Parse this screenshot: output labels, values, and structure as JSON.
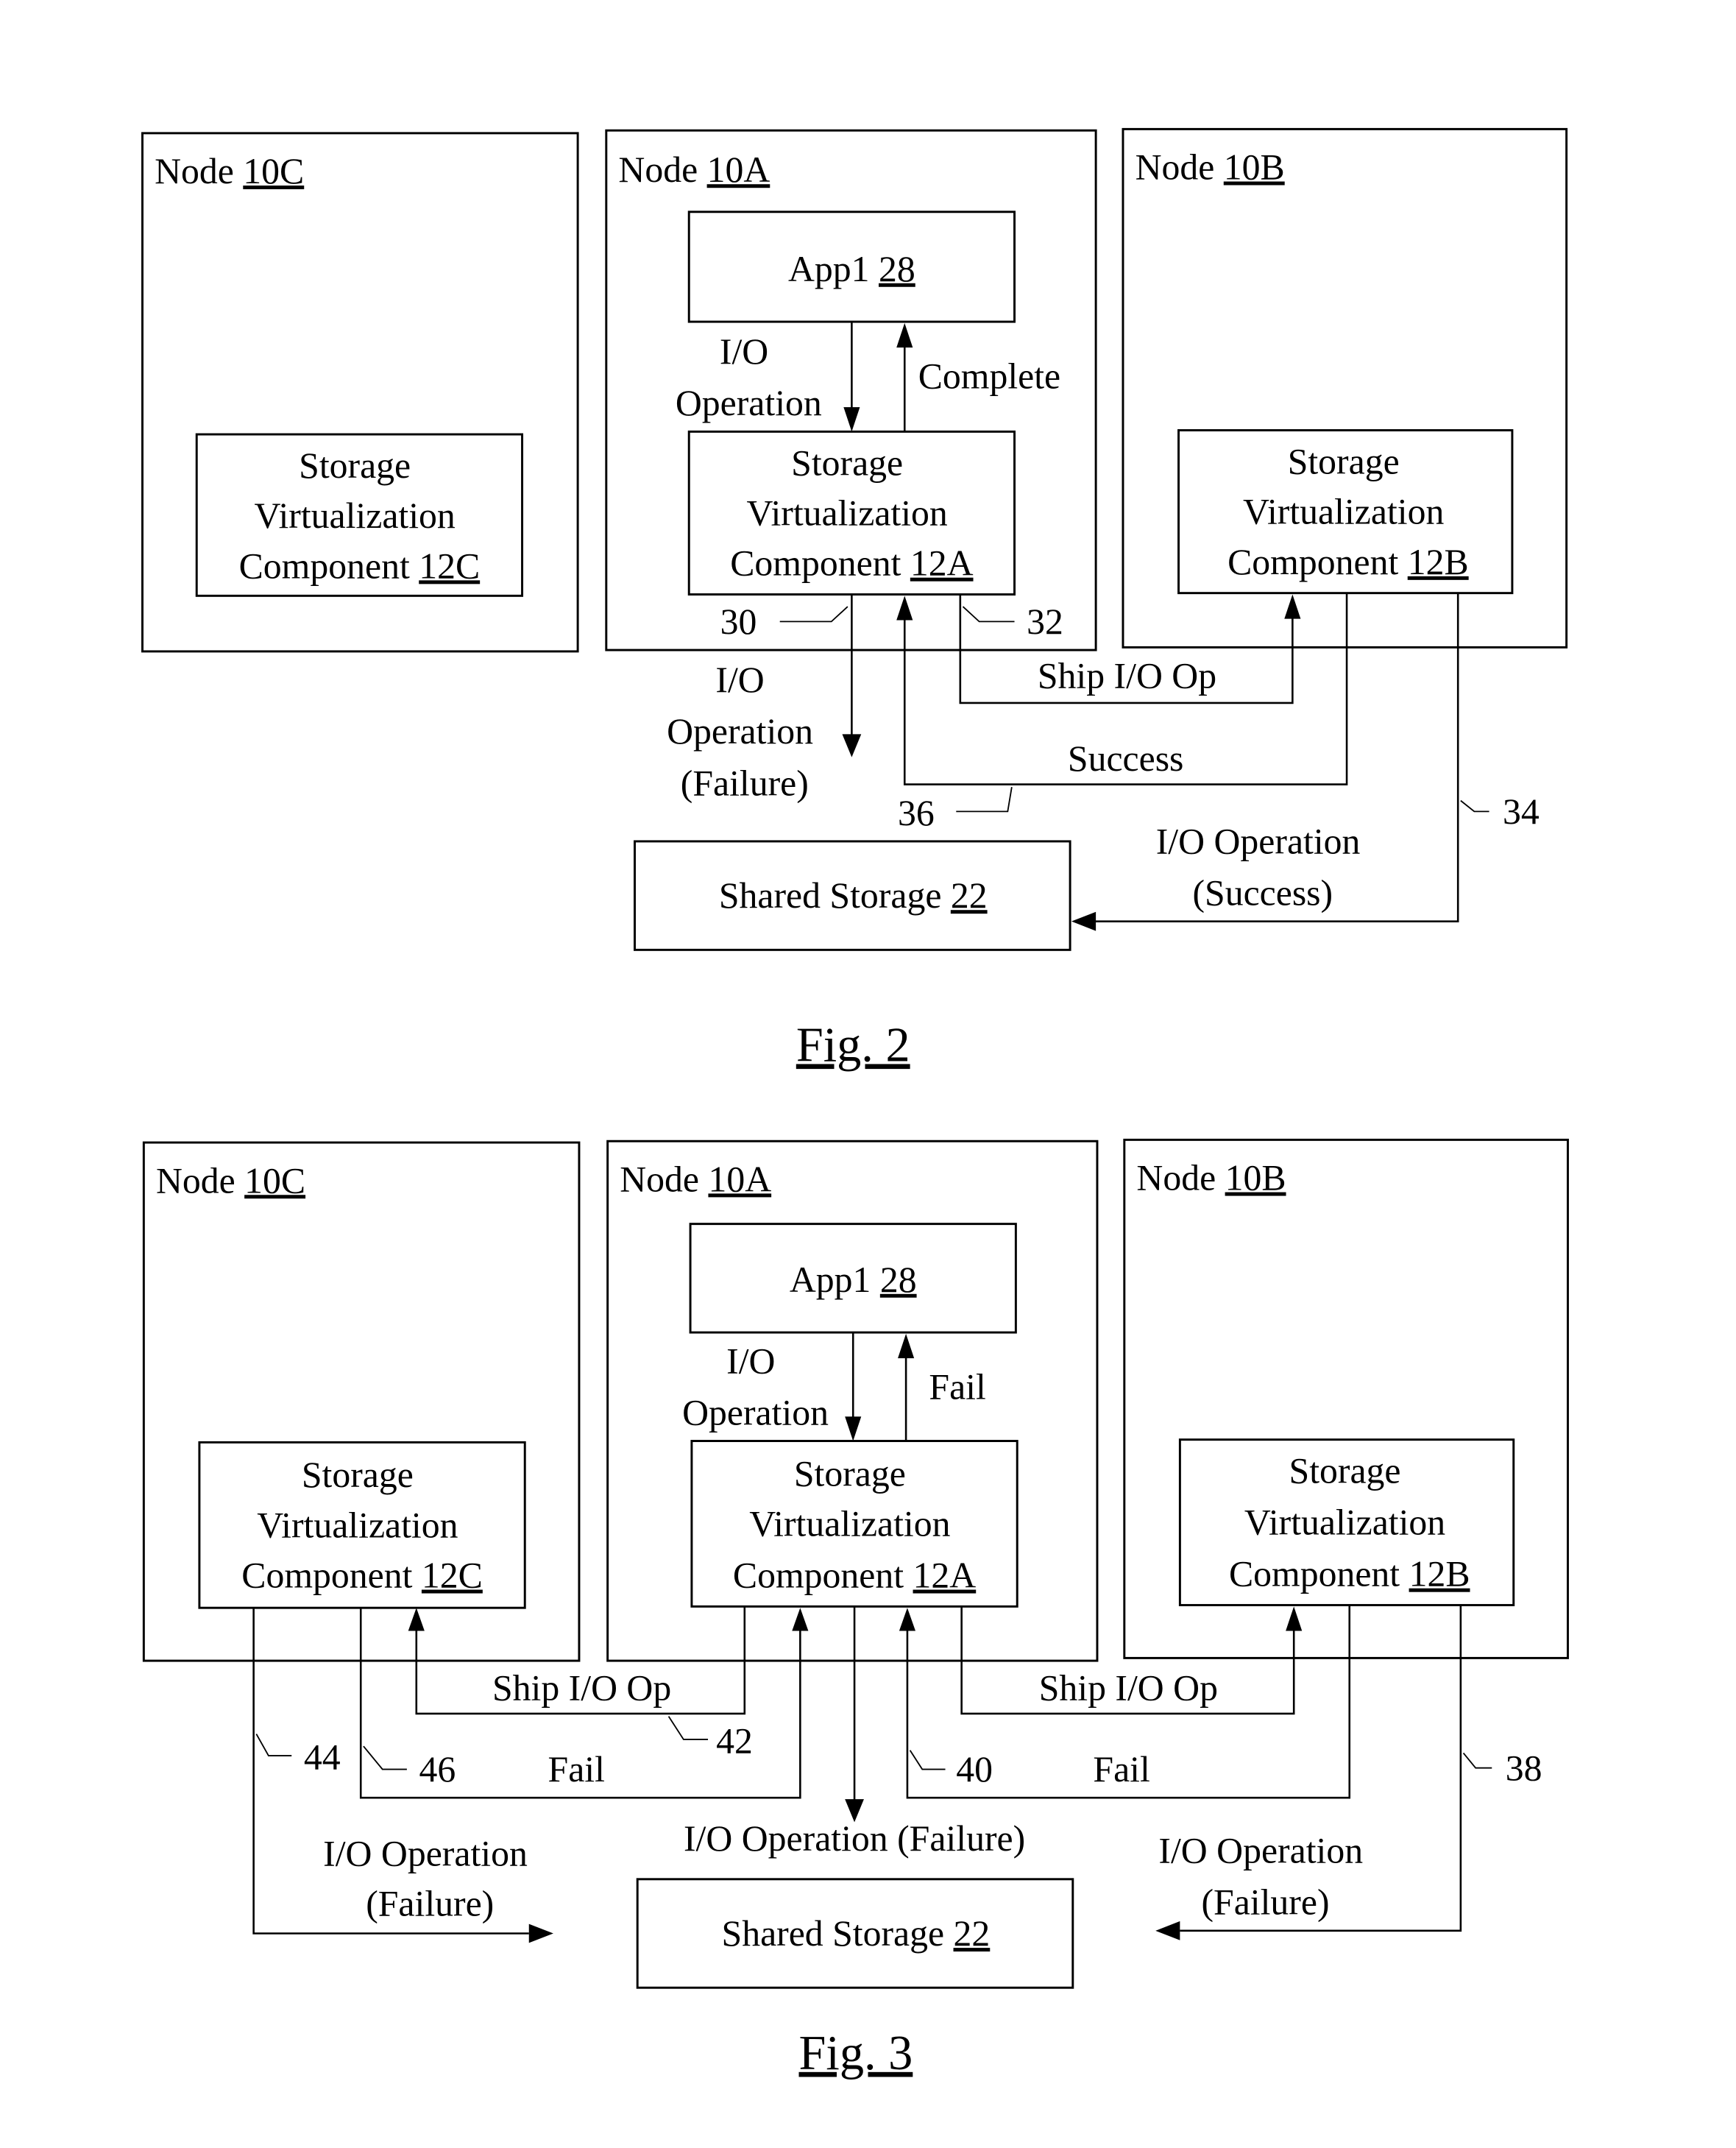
{
  "fig2": {
    "caption": "Fig. 2",
    "node_c": {
      "label": "Node ",
      "ref": "10C"
    },
    "node_a": {
      "label": "Node ",
      "ref": "10A"
    },
    "node_b": {
      "label": "Node ",
      "ref": "10B"
    },
    "app": {
      "label": "App1 ",
      "ref": "28"
    },
    "svc_c": {
      "line1": "Storage",
      "line2": "Virtualization",
      "line3": "Component ",
      "ref": "12C"
    },
    "svc_a": {
      "line1": "Storage",
      "line2": "Virtualization",
      "line3": "Component ",
      "ref": "12A"
    },
    "svc_b": {
      "line1": "Storage",
      "line2": "Virtualization",
      "line3": "Component ",
      "ref": "12B"
    },
    "shared": {
      "label": "Shared Storage ",
      "ref": "22"
    },
    "io_op": {
      "line1": "I/O",
      "line2": "Operation"
    },
    "complete": "Complete",
    "io_fail": {
      "line1": "I/O",
      "line2": "Operation",
      "line3": "(Failure)"
    },
    "ship": "Ship I/O Op",
    "success": "Success",
    "io_success": {
      "line1": "I/O Operation",
      "line2": "(Success)"
    },
    "refs": {
      "r30": "30",
      "r32": "32",
      "r34": "34",
      "r36": "36"
    }
  },
  "fig3": {
    "caption": "Fig. 3",
    "node_c": {
      "label": "Node ",
      "ref": "10C"
    },
    "node_a": {
      "label": "Node ",
      "ref": "10A"
    },
    "node_b": {
      "label": "Node ",
      "ref": "10B"
    },
    "app": {
      "label": "App1 ",
      "ref": "28"
    },
    "svc_c": {
      "line1": "Storage",
      "line2": "Virtualization",
      "line3": "Component ",
      "ref": "12C"
    },
    "svc_a": {
      "line1": "Storage",
      "line2": "Virtualization",
      "line3": "Component ",
      "ref": "12A"
    },
    "svc_b": {
      "line1": "Storage",
      "line2": "Virtualization",
      "line3": "Component ",
      "ref": "12B"
    },
    "shared": {
      "label": "Shared Storage ",
      "ref": "22"
    },
    "io_op": {
      "line1": "I/O",
      "line2": "Operation"
    },
    "fail": "Fail",
    "ship_left": "Ship I/O Op",
    "ship_right": "Ship I/O Op",
    "fail_left": "Fail",
    "fail_right": "Fail",
    "io_fail_center": "I/O Operation (Failure)",
    "io_fail_left": {
      "line1": "I/O Operation",
      "line2": "(Failure)"
    },
    "io_fail_right": {
      "line1": "I/O Operation",
      "line2": "(Failure)"
    },
    "refs": {
      "r38": "38",
      "r40": "40",
      "r42": "42",
      "r44": "44",
      "r46": "46"
    }
  }
}
